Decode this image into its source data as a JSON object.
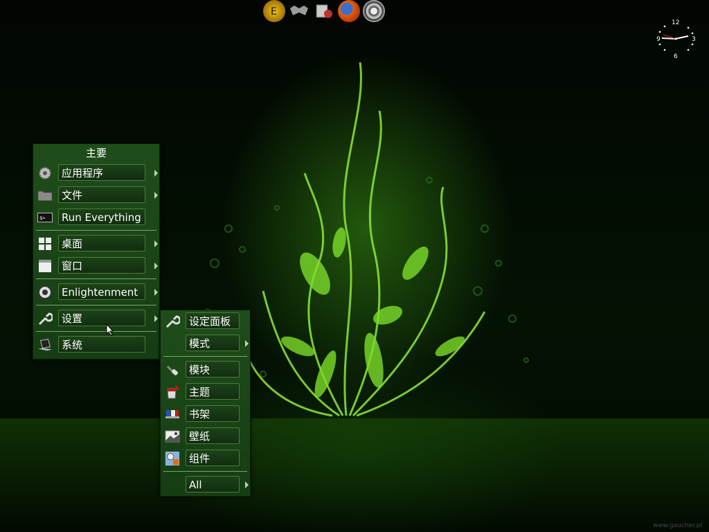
{
  "shelf": {
    "apps": [
      {
        "icon": "enlightenment-icon",
        "color": "#d8a000"
      },
      {
        "icon": "bat-icon",
        "color": "#9a9a9a"
      },
      {
        "icon": "file-manager-icon",
        "color": "#c03030"
      },
      {
        "icon": "firefox-icon",
        "color": "#e06010"
      },
      {
        "icon": "power-icon",
        "color": "#cccccc"
      }
    ]
  },
  "clock": {
    "n12": "12",
    "n3": "3",
    "n6": "6",
    "n9": "9"
  },
  "main_menu": {
    "title": "主要",
    "items": [
      {
        "label": "应用程序",
        "icon": "gear-icon",
        "submenu": true
      },
      {
        "label": "文件",
        "icon": "folder-icon",
        "submenu": true
      },
      {
        "label": "Run Everything",
        "icon": "terminal-icon",
        "submenu": false
      },
      {
        "label": "桌面",
        "icon": "desktop-grid-icon",
        "submenu": true
      },
      {
        "label": "窗口",
        "icon": "window-icon",
        "submenu": true
      },
      {
        "label": "Enlightenment",
        "icon": "enlightenment-icon",
        "submenu": true
      },
      {
        "label": "设置",
        "icon": "wrench-icon",
        "submenu": true
      },
      {
        "label": "系统",
        "icon": "laptop-icon",
        "submenu": false
      }
    ]
  },
  "settings_menu": {
    "items": [
      {
        "label": "设定面板",
        "icon": "wrench-icon",
        "submenu": false
      },
      {
        "label": "模式",
        "icon": "",
        "submenu": true
      },
      {
        "label": "模块",
        "icon": "plug-icon",
        "submenu": false
      },
      {
        "label": "主题",
        "icon": "paint-bucket-icon",
        "submenu": false
      },
      {
        "label": "书架",
        "icon": "shelf-icon",
        "submenu": false
      },
      {
        "label": "壁纸",
        "icon": "wallpaper-icon",
        "submenu": false
      },
      {
        "label": "组件",
        "icon": "gadgets-icon",
        "submenu": false
      },
      {
        "label": "All",
        "icon": "",
        "submenu": true
      }
    ]
  },
  "watermark": "www.gaucher.pl",
  "colors": {
    "menu_bg": "#1f4d1a",
    "menu_border": "#4c7c3a",
    "accent_green": "#7ddc2a"
  }
}
